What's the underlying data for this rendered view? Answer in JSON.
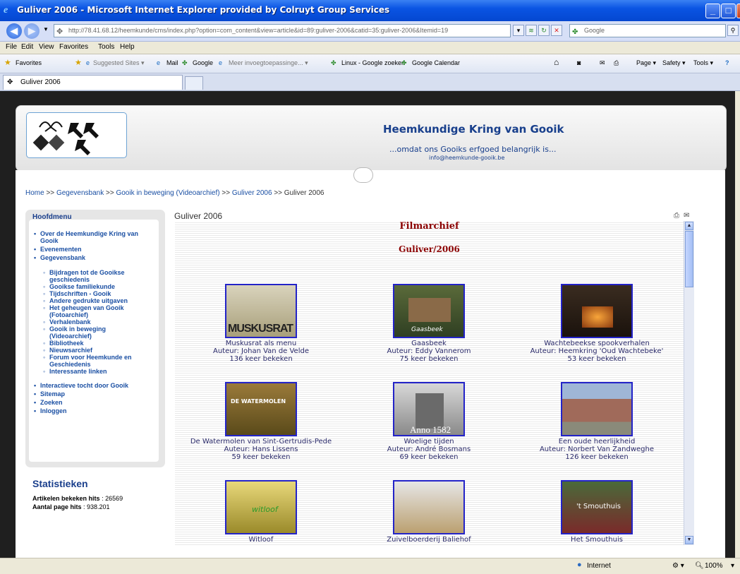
{
  "window": {
    "title": "Guliver 2006 - Microsoft Internet Explorer provided by Colruyt Group Services"
  },
  "address": {
    "url": "http://78.41.68.12/heemkunde/cms/index.php?option=com_content&view=article&id=89:guliver-2006&catid=35:guliver-2006&Itemid=19",
    "search_placeholder": "Google"
  },
  "menubar": [
    "File",
    "Edit",
    "View",
    "Favorites",
    "Tools",
    "Help"
  ],
  "favorites_bar": {
    "favorites": "Favorites",
    "items": [
      "Suggested Sites ▾",
      "Mail",
      "Google",
      "Meer invoegtoepassinge... ▾",
      "Linux - Google zoeken",
      "Google Calendar"
    ],
    "right_items": [
      "Page ▾",
      "Safety ▾",
      "Tools ▾"
    ]
  },
  "tab": {
    "label": "Guliver 2006"
  },
  "site": {
    "title": "Heemkundige Kring van Gooik",
    "slogan": "...omdat ons Gooiks erfgoed belangrijk is...",
    "email": "info@heemkunde-gooik.be"
  },
  "breadcrumb": {
    "items": [
      "Home",
      "Gegevensbank",
      "Gooik in beweging (Videoarchief)",
      "Guliver 2006"
    ],
    "current": "Guliver 2006",
    "sep": ">>"
  },
  "sidebar": {
    "title": "Hoofdmenu",
    "items": [
      "Over de Heemkundige Kring van",
      "Gooik",
      "Evenementen",
      "Gegevensbank"
    ],
    "sub_items": [
      "Bijdragen tot de Gooikse",
      "geschiedenis",
      "Gooikse familiekunde",
      "Tijdschriften - Gooik",
      "Andere gedrukte uitgaven",
      "Het geheugen van Gooik",
      "(Fotoarchief)",
      "Verhalenbank",
      "Gooik in beweging",
      "(Videoarchief)",
      "Bibliotheek",
      "Nieuwsarchief",
      "Forum voor Heemkunde en",
      "Geschiedenis",
      "Interessante linken"
    ],
    "bottom_items": [
      "Interactieve tocht door Gooik",
      "Sitemap",
      "Zoeken",
      "Inloggen"
    ]
  },
  "stats": {
    "title": "Statistieken",
    "articles_label": "Artikelen bekeken hits",
    "articles_value": ": 26569",
    "pages_label": "Aantal page hits",
    "pages_value": ": 938.201"
  },
  "article": {
    "title": "Guliver 2006",
    "filmarchief": "Filmarchief",
    "subtitle": "Guliver/2006",
    "videos": [
      {
        "title": "Muskusrat als menu",
        "author": "Auteur: Johan Van de Velde",
        "views": "136 keer bekeken",
        "thumb_text": "MUSKUSRAT"
      },
      {
        "title": "Gaasbeek",
        "author": "Auteur: Eddy Vannerom",
        "views": "75 keer bekeken",
        "thumb_text": "Gaasbeek"
      },
      {
        "title": "Wachtebeekse spookverhalen",
        "author": "Auteur: Heemkring 'Oud Wachtebeke'",
        "views": "53 keer bekeken",
        "thumb_text": ""
      },
      {
        "title": "De Watermolen van Sint-Gertrudis-Pede",
        "author": "Auteur: Hans Lissens",
        "views": "59 keer bekeken",
        "thumb_text": "DE WATERMOLEN"
      },
      {
        "title": "Woelige tijden",
        "author": "Auteur: André Bosmans",
        "views": "69 keer bekeken",
        "thumb_text": "Anno 1582"
      },
      {
        "title": "Een oude heerlijkheid",
        "author": "Auteur: Norbert Van Zandweghe",
        "views": "126 keer bekeken",
        "thumb_text": ""
      },
      {
        "title": "Witloof",
        "author": "",
        "views": "",
        "thumb_text": "witloof"
      },
      {
        "title": "Zuivelboerderij Baliehof",
        "author": "",
        "views": "",
        "thumb_text": ""
      },
      {
        "title": "Het Smouthuis",
        "author": "",
        "views": "",
        "thumb_text": "'t Smouthuis"
      }
    ]
  },
  "status": {
    "zone": "Internet",
    "zoom": "100%"
  }
}
